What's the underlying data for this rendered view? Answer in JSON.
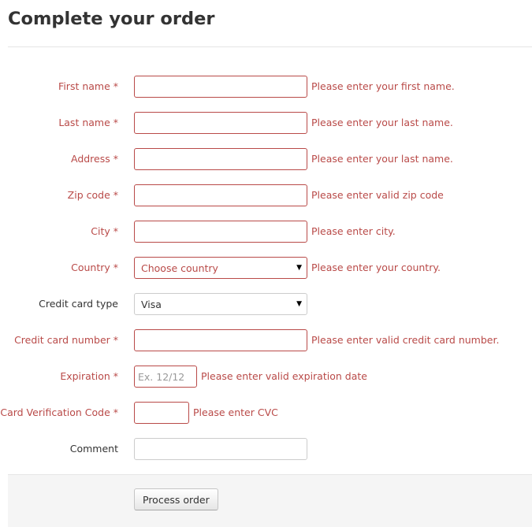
{
  "page": {
    "title": "Complete your order"
  },
  "form": {
    "first_name": {
      "label": "First name *",
      "value": "",
      "help": "Please enter your first name."
    },
    "last_name": {
      "label": "Last name *",
      "value": "",
      "help": "Please enter your last name."
    },
    "address": {
      "label": "Address *",
      "value": "",
      "help": "Please enter your last name."
    },
    "zip_code": {
      "label": "Zip code *",
      "value": "",
      "help": "Please enter valid zip code"
    },
    "city": {
      "label": "City *",
      "value": "",
      "help": "Please enter city."
    },
    "country": {
      "label": "Country *",
      "selected": "Choose country",
      "help": "Please enter your country."
    },
    "card_type": {
      "label": "Credit card type",
      "selected": "Visa"
    },
    "card_number": {
      "label": "Credit card number *",
      "value": "",
      "help": "Please enter valid credit card number."
    },
    "expiration": {
      "label": "Expiration *",
      "placeholder": "Ex. 12/12",
      "help": "Please enter valid expiration date"
    },
    "cvc": {
      "label": "Card Verification Code *",
      "value": "",
      "help": "Please enter CVC"
    },
    "comment": {
      "label": "Comment",
      "value": ""
    }
  },
  "actions": {
    "submit_label": "Process order"
  },
  "colors": {
    "error": "#b94a48",
    "text": "#333333",
    "actions_bg": "#f5f5f5"
  },
  "icons": {
    "select_arrow": "caret-down-icon"
  }
}
